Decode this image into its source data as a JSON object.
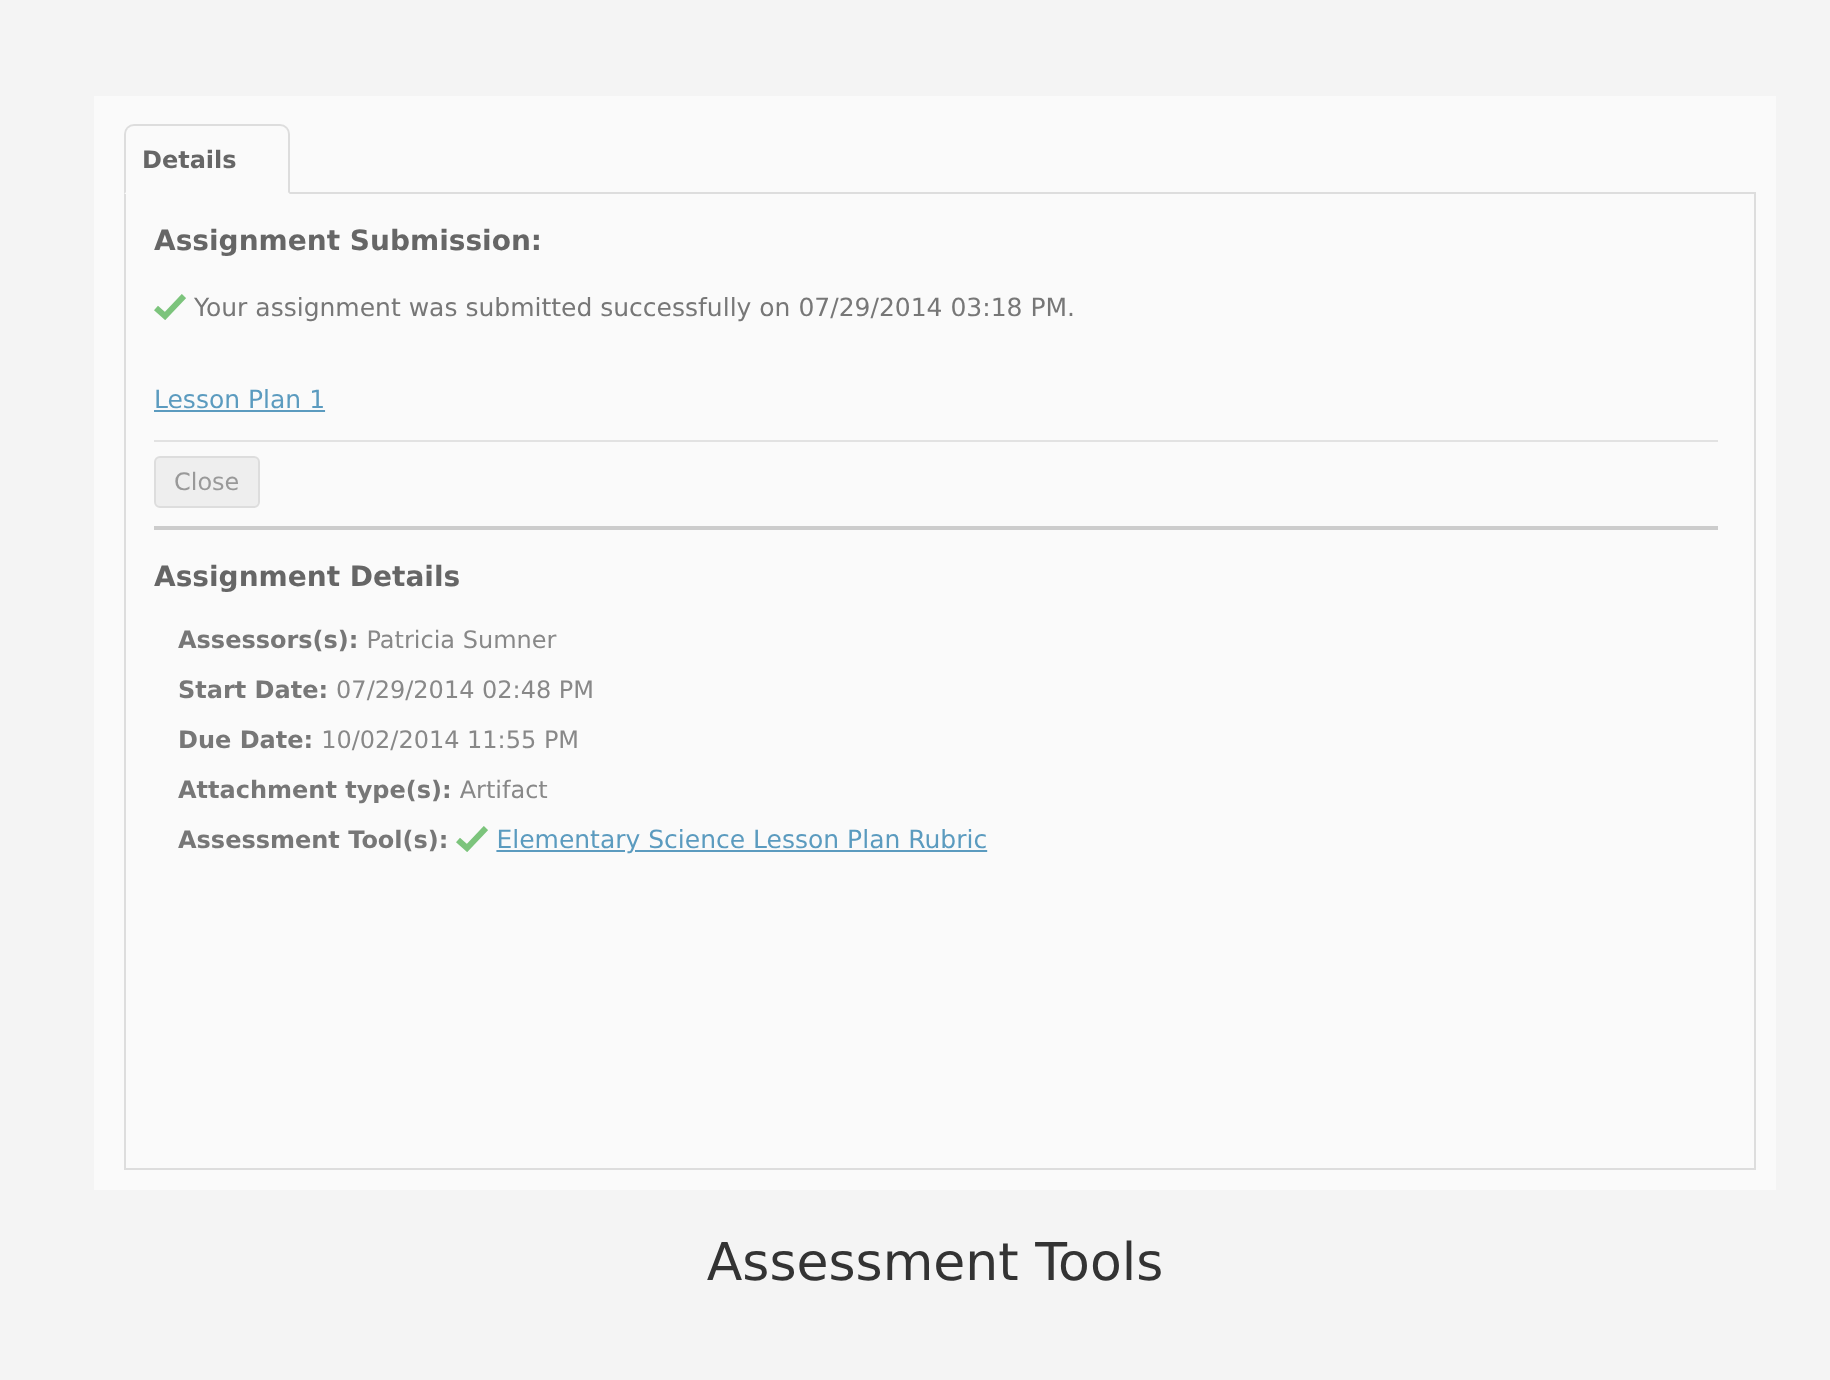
{
  "tabs": [
    {
      "label": "Details",
      "selected": true
    }
  ],
  "submission": {
    "heading": "Assignment Submission:",
    "message": "Your assignment was submitted successfully on 07/29/2014 03:18 PM.",
    "link": "Lesson Plan 1",
    "close_button": "Close"
  },
  "details": {
    "heading": "Assignment Details",
    "rows": [
      {
        "label": "Assessors(s):",
        "value": "Patricia Sumner",
        "kind": "text"
      },
      {
        "label": "Start Date:",
        "value": "07/29/2014 02:48 PM",
        "kind": "text"
      },
      {
        "label": "Due Date:",
        "value": "10/02/2014 11:55 PM",
        "kind": "text"
      },
      {
        "label": "Attachment type(s):",
        "value": "Artifact",
        "kind": "text"
      },
      {
        "label": "Assessment Tool(s):",
        "value": "Elementary Science Lesson Plan Rubric",
        "kind": "checked-link"
      }
    ]
  },
  "caption": "Assessment Tools"
}
